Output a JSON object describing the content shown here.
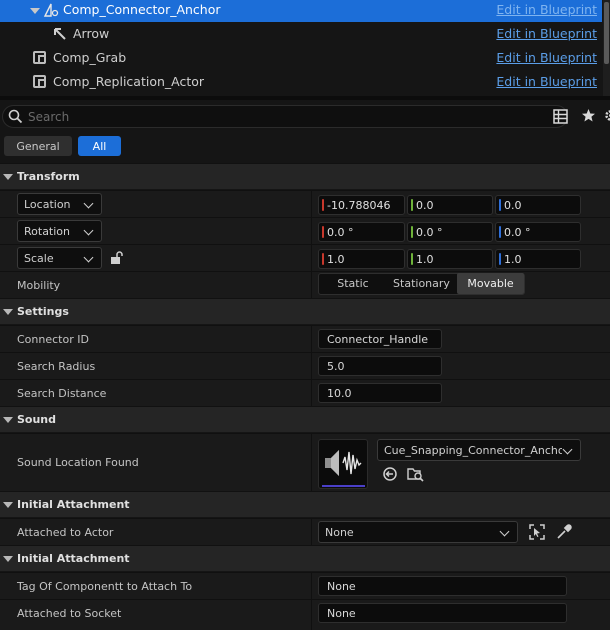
{
  "tree": {
    "items": [
      {
        "label": "Comp_Connector_Anchor",
        "action": "Edit in Blueprint"
      },
      {
        "label": "Arrow",
        "action": "Edit in Blueprint"
      },
      {
        "label": "Comp_Grab",
        "action": "Edit in Blueprint"
      },
      {
        "label": "Comp_Replication_Actor",
        "action": "Edit in Blueprint"
      }
    ]
  },
  "search": {
    "placeholder": "Search"
  },
  "filters": {
    "general": "General",
    "all": "All"
  },
  "transform": {
    "title": "Transform",
    "location": {
      "label": "Location",
      "x": "-10.788046",
      "y": "0.0",
      "z": "0.0"
    },
    "rotation": {
      "label": "Rotation",
      "x": "0.0 °",
      "y": "0.0 °",
      "z": "0.0 °"
    },
    "scale": {
      "label": "Scale",
      "x": "1.0",
      "y": "1.0",
      "z": "1.0"
    },
    "mobility": {
      "label": "Mobility",
      "options": [
        "Static",
        "Stationary",
        "Movable"
      ],
      "selected": "Movable"
    }
  },
  "settings": {
    "title": "Settings",
    "connector_id": {
      "label": "Connector ID",
      "value": "Connector_Handle"
    },
    "search_radius": {
      "label": "Search Radius",
      "value": "5.0"
    },
    "search_distance": {
      "label": "Search Distance",
      "value": "10.0"
    }
  },
  "sound": {
    "title": "Sound",
    "location_found": {
      "label": "Sound Location Found",
      "asset": "Cue_Snapping_Connector_Anchor_"
    }
  },
  "attachment1": {
    "title": "Initial Attachment",
    "attached_to_actor": {
      "label": "Attached to Actor",
      "value": "None"
    }
  },
  "attachment2": {
    "title": "Initial Attachment",
    "tag": {
      "label": "Tag Of Componentt to Attach To",
      "value": "None"
    },
    "socket": {
      "label": "Attached to Socket",
      "value": "None"
    }
  },
  "colors": {
    "accent": "#1c6ed8",
    "x_axis": "#c8382c",
    "y_axis": "#6fb33a",
    "z_axis": "#2f6fd8",
    "link": "#5b9ee8"
  }
}
